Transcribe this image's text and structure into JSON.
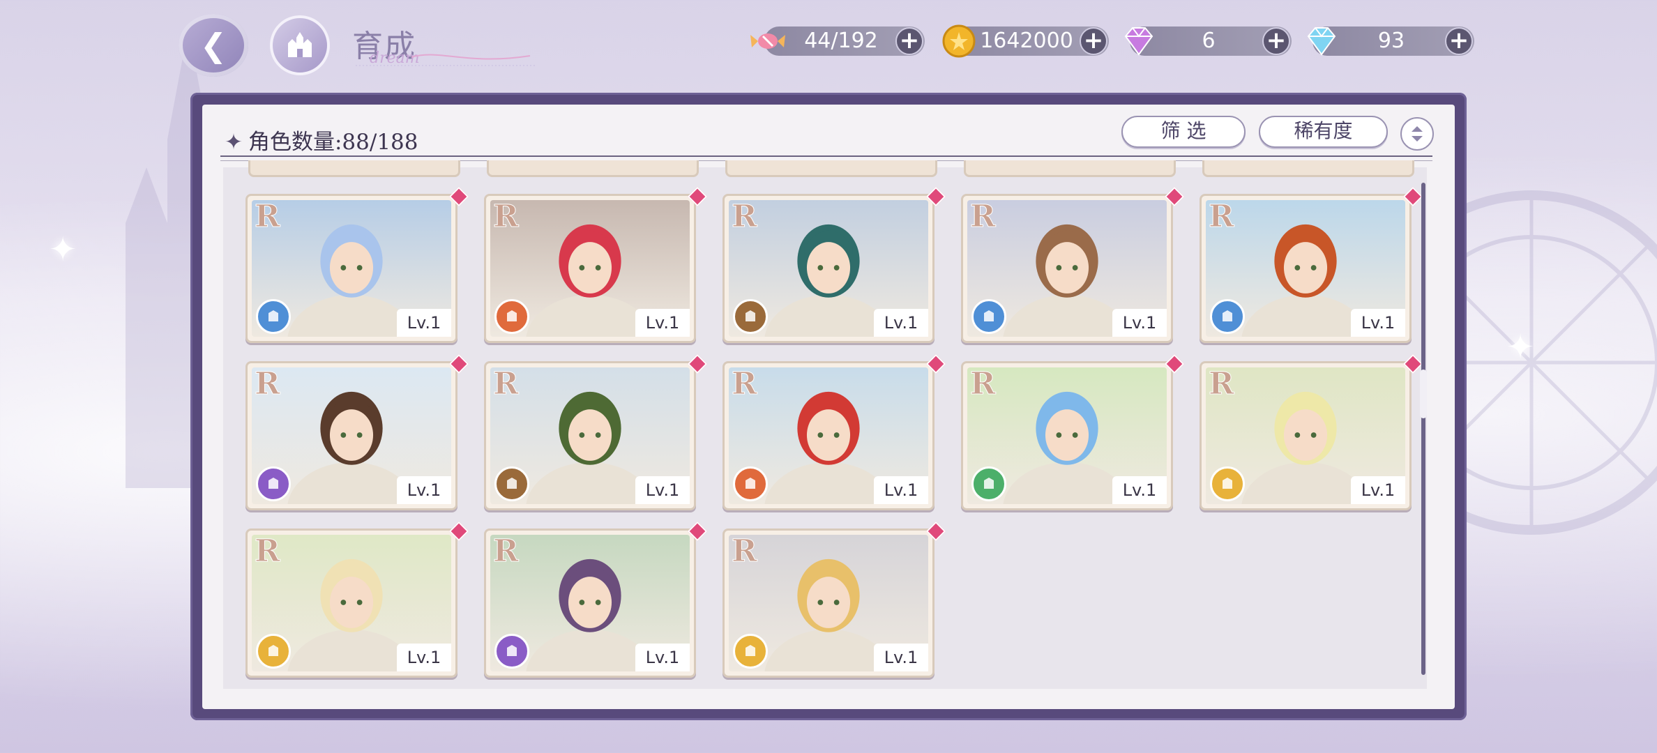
{
  "header": {
    "title": "育成",
    "title_deco": "dream"
  },
  "resources": [
    {
      "name": "stamina",
      "icon": "candy-icon",
      "value": "44/192"
    },
    {
      "name": "coins",
      "icon": "coin-icon",
      "value": "1642000"
    },
    {
      "name": "premium-gems",
      "icon": "gem-icon",
      "value": "6"
    },
    {
      "name": "diamonds",
      "icon": "diamond-icon",
      "value": "93"
    }
  ],
  "panel": {
    "count_label": "角色数量:88/188",
    "filter_label": "筛 选",
    "rarity_label": "稀有度"
  },
  "colors": {
    "frame": "#584a7c",
    "accent_gem": "#e0497a"
  },
  "cards": [
    {
      "rarity": "R",
      "level": "Lv.1",
      "role": "blue",
      "hair": "#a9c4ec",
      "sky": "#b6cde6"
    },
    {
      "rarity": "R",
      "level": "Lv.1",
      "role": "orange",
      "hair": "#d8394c",
      "sky": "#c7b8b0"
    },
    {
      "rarity": "R",
      "level": "Lv.1",
      "role": "brown",
      "hair": "#2f6d6a",
      "sky": "#c2cfe0"
    },
    {
      "rarity": "R",
      "level": "Lv.1",
      "role": "blue",
      "hair": "#9a6b4a",
      "sky": "#c9cde0"
    },
    {
      "rarity": "R",
      "level": "Lv.1",
      "role": "blue",
      "hair": "#c85628",
      "sky": "#bcd7ea"
    },
    {
      "rarity": "R",
      "level": "Lv.1",
      "role": "purple",
      "hair": "#5a3c2c",
      "sky": "#dce8f2"
    },
    {
      "rarity": "R",
      "level": "Lv.1",
      "role": "brown",
      "hair": "#4e6a34",
      "sky": "#d4dfe8"
    },
    {
      "rarity": "R",
      "level": "Lv.1",
      "role": "orange",
      "hair": "#d23a34",
      "sky": "#c8dcea"
    },
    {
      "rarity": "R",
      "level": "Lv.1",
      "role": "green",
      "hair": "#7fb8ea",
      "sky": "#d6e8c0"
    },
    {
      "rarity": "R",
      "level": "Lv.1",
      "role": "yellow",
      "hair": "#eee8a8",
      "sky": "#dfe6c4"
    },
    {
      "rarity": "R",
      "level": "Lv.1",
      "role": "yellow",
      "hair": "#f0e1b4",
      "sky": "#dfe8c6"
    },
    {
      "rarity": "R",
      "level": "Lv.1",
      "role": "purple",
      "hair": "#6b4e7c",
      "sky": "#c6d8c0"
    },
    {
      "rarity": "R",
      "level": "Lv.1",
      "role": "yellow",
      "hair": "#e8c06a",
      "sky": "#d6d4d8"
    }
  ]
}
